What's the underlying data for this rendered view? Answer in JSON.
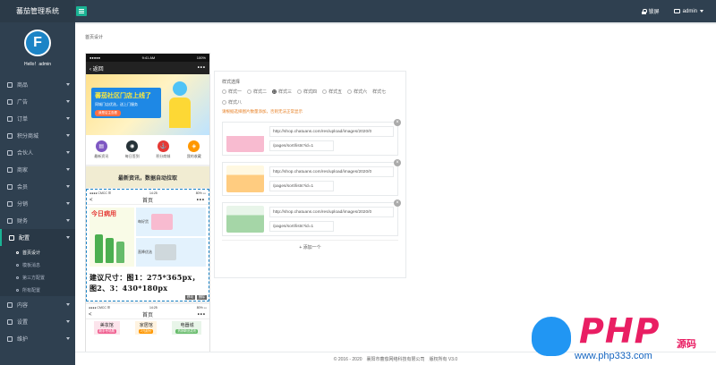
{
  "app": {
    "title": "蕃茄管理系统"
  },
  "topbar": {
    "lock_label": "锁屏",
    "user_label": "admin"
  },
  "sidebar": {
    "avatar_letter": "F",
    "hello": "Hello！admin",
    "items": [
      {
        "label": "商品"
      },
      {
        "label": "广告"
      },
      {
        "label": "订单"
      },
      {
        "label": "积分商城"
      },
      {
        "label": "合伙人"
      },
      {
        "label": "商家"
      },
      {
        "label": "会员"
      },
      {
        "label": "分销"
      },
      {
        "label": "财务"
      },
      {
        "label": "配置"
      },
      {
        "label": "内容"
      },
      {
        "label": "设置"
      },
      {
        "label": "维护"
      }
    ],
    "sub_items": [
      {
        "label": "首页设计"
      },
      {
        "label": "模板消息"
      },
      {
        "label": "第三方配置"
      },
      {
        "label": "所有配置"
      }
    ]
  },
  "breadcrumb": "首页设计",
  "phone": {
    "status_carrier": "●●●●●",
    "status_time": "9:41 AM",
    "status_battery": "100%",
    "nav_back": "返回",
    "nav_more": "•••",
    "banner_title": "蕃茄社区门店上线了",
    "banner_sub": "同城门店优选，送上门服务",
    "banner_btn": "我是店主查看",
    "icons": [
      {
        "label": "最新资讯",
        "color": "#7e57c2",
        "glyph": "▤"
      },
      {
        "label": "每日签到",
        "color": "#263238",
        "glyph": "◉"
      },
      {
        "label": "积分商城",
        "color": "#e53935",
        "glyph": "⚓"
      },
      {
        "label": "我的收藏",
        "color": "#ff9800",
        "glyph": "◈"
      }
    ],
    "notice": "最新资讯，数据自动拉取",
    "mini_status_left": "●●●● CMCC ☰",
    "mini_status_time": "14:25",
    "mini_status_right": "80% ▭",
    "mini_title": "首页",
    "mini_back": "<",
    "mini_more": "•••",
    "promo_hot": "今日病用",
    "promo_box1": "每好货",
    "promo_box2": "直降优选",
    "size_note_line1": "建议尺寸：图1：275*365px，",
    "size_note_line2": "图2、3：430*180px",
    "block_tools": [
      "移动",
      "删除"
    ],
    "second_status_left": "●●●● CMCC ☰",
    "second_status_time": "14:25",
    "second_status_right": "80% ▭",
    "second_title": "首页",
    "tags": [
      {
        "label": "美妆馆",
        "sub": "新手专场展"
      },
      {
        "label": "家居馆",
        "sub": "2元起价"
      },
      {
        "label": "电器城",
        "sub": "热销新品发布"
      }
    ]
  },
  "editor": {
    "style_title": "样式选择",
    "styles": [
      "样式一",
      "样式二",
      "样式三",
      "样式四",
      "样式五",
      "样式六",
      "样式七",
      "样式八"
    ],
    "selected_style": "样式三",
    "warning": "请根据选择图片数量添加，否则无法正常显示",
    "rows": [
      {
        "img_url": "http://shop.chatuans.com/res/upload/images/2020/0",
        "link": "/pages/sort/lists?id=1"
      },
      {
        "img_url": "http://shop.chatuans.com/res/upload/images/2020/0",
        "link": "/pages/sort/lists?id=1"
      },
      {
        "img_url": "http://shop.chatuans.com/res/upload/images/2020/0",
        "link": "/pages/sort/lists?id=1"
      }
    ],
    "add_one": "+ 添加一个"
  },
  "footer": "© 2016 - 2020　襄阳市蕃茄网络科技有限公司　版权所有 V3.0",
  "watermark": {
    "brand": "PHP",
    "suffix": "源码",
    "url": "www.php333.com"
  }
}
